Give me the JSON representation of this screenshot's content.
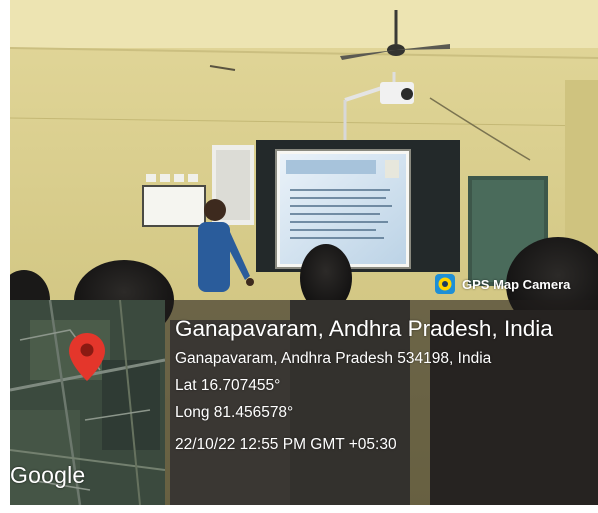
{
  "app": {
    "badge_label": "GPS Map Camera"
  },
  "location": {
    "title": "Ganapavaram, Andhra Pradesh, India",
    "address": "Ganapavaram, Andhra Pradesh 534198, India",
    "latitude": "Lat 16.707455°",
    "longitude": "Long 81.456578°",
    "timestamp": "22/10/22 12:55 PM GMT +05:30"
  },
  "map": {
    "provider_label": "Google",
    "pin_color": "#E4362B"
  },
  "colors": {
    "wall": "#D8CC85",
    "overlay": "#201E1C",
    "text": "#FFFFFF"
  }
}
